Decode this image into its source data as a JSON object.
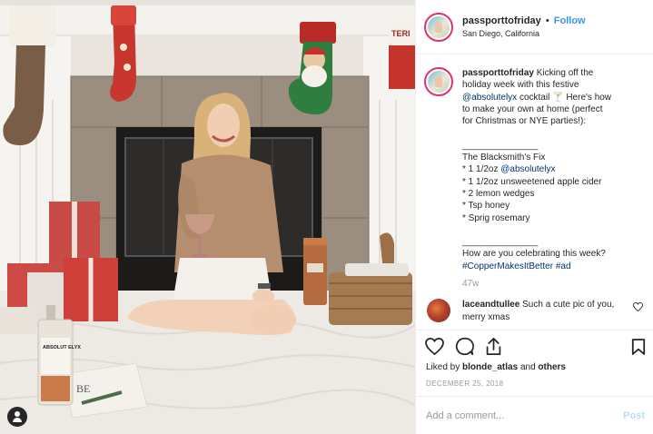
{
  "header": {
    "username": "passporttofriday",
    "separator": "•",
    "follow_label": "Follow",
    "location": "San Diego, California"
  },
  "caption": {
    "username": "passporttofriday",
    "lines": [
      {
        "parts": [
          {
            "t": "Kicking off the",
            "k": "text"
          }
        ]
      },
      {
        "parts": [
          {
            "t": "holiday week with this festive",
            "k": "text"
          }
        ]
      },
      {
        "parts": [
          {
            "t": "@absolutelyx",
            "k": "link"
          },
          {
            "t": " cocktail ",
            "k": "text"
          },
          {
            "t": "🍸",
            "k": "text"
          },
          {
            "t": " Here's how",
            "k": "text"
          }
        ]
      },
      {
        "parts": [
          {
            "t": "to make your own at home (perfect",
            "k": "text"
          }
        ]
      },
      {
        "parts": [
          {
            "t": "for Christmas or NYE parties!):",
            "k": "text"
          }
        ]
      },
      {
        "parts": [
          {
            "t": "",
            "k": "text"
          }
        ]
      },
      {
        "parts": [
          {
            "t": "_______________",
            "k": "text"
          }
        ]
      },
      {
        "parts": [
          {
            "t": "The Blacksmith's Fix",
            "k": "text"
          }
        ]
      },
      {
        "parts": [
          {
            "t": "* 1 1/2oz ",
            "k": "text"
          },
          {
            "t": "@absolutelyx",
            "k": "link"
          }
        ]
      },
      {
        "parts": [
          {
            "t": "* 1 1/2oz unsweetened apple cider",
            "k": "text"
          }
        ]
      },
      {
        "parts": [
          {
            "t": "* 2 lemon wedges",
            "k": "text"
          }
        ]
      },
      {
        "parts": [
          {
            "t": "* Tsp honey",
            "k": "text"
          }
        ]
      },
      {
        "parts": [
          {
            "t": "* Sprig rosemary",
            "k": "text"
          }
        ]
      },
      {
        "parts": [
          {
            "t": "",
            "k": "text"
          }
        ]
      },
      {
        "parts": [
          {
            "t": "_______________",
            "k": "text"
          }
        ]
      },
      {
        "parts": [
          {
            "t": "How are you celebrating this week?",
            "k": "text"
          }
        ]
      },
      {
        "parts": [
          {
            "t": "#CopperMakesItBetter",
            "k": "hash"
          },
          {
            "t": " ",
            "k": "text"
          },
          {
            "t": "#ad",
            "k": "hash"
          }
        ]
      }
    ],
    "time": "47w"
  },
  "comments": [
    {
      "username": "laceandtullee",
      "text": "Such a cute pic of you, merry xmas"
    }
  ],
  "likes": {
    "prefix": "Liked by",
    "user": "blonde_atlas",
    "middle": "and",
    "others": "others"
  },
  "date": "DECEMBER 25, 2018",
  "add_comment": {
    "placeholder": "Add a comment...",
    "post_label": "Post"
  },
  "photo": {
    "bottle_label": "ABSOLUT ELYX",
    "stocking_name": "TERI",
    "sign_text": "BE"
  }
}
